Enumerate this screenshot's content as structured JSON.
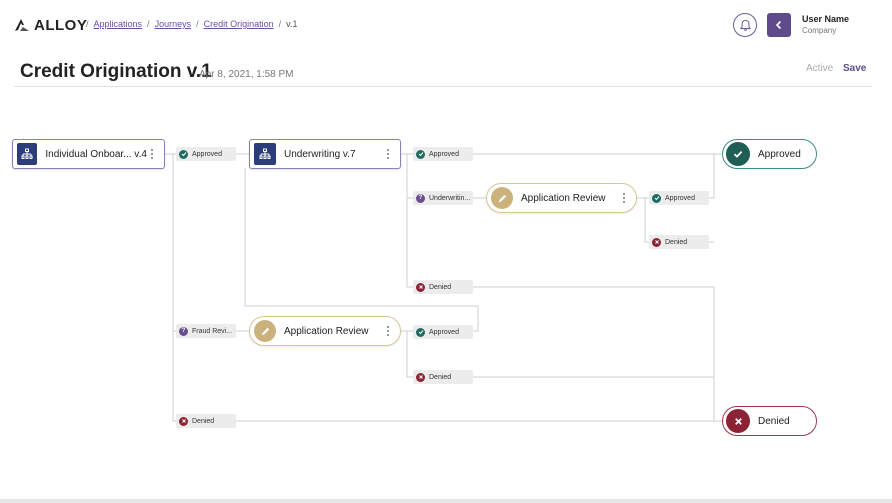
{
  "header": {
    "logo_text": "ALLOY",
    "breadcrumb": [
      {
        "label": "Applications"
      },
      {
        "label": "Journeys"
      },
      {
        "label": "Credit Origination"
      }
    ],
    "breadcrumb_current": "v.1",
    "user_name": "User Name",
    "company": "Company"
  },
  "page": {
    "title": "Credit Origination v.1",
    "timestamp": "Apr 8, 2021, 1:58 PM",
    "status": "Active",
    "save_label": "Save"
  },
  "nodes": {
    "individual_onboarding": "Individual Onboar... v.4",
    "underwriting": "Underwriting v.7",
    "application_review_1": "Application Review",
    "application_review_2": "Application Review",
    "approved_terminal": "Approved",
    "denied_terminal": "Denied"
  },
  "edges": {
    "onboarding_approved": "Approved",
    "onboarding_fraud": "Fraud Revi...",
    "onboarding_denied": "Denied",
    "underwriting_approved": "Approved",
    "underwriting_review": "Underwritin...",
    "underwriting_denied": "Denied",
    "review1_approved": "Approved",
    "review1_denied": "Denied",
    "review2_approved": "Approved",
    "review2_denied": "Denied"
  },
  "colors": {
    "brand_purple": "#5f4b8b",
    "approved_green": "#1e5e54",
    "denied_red": "#8c2335",
    "review_gold": "#cbb27c",
    "journey_blue": "#2c3e7a"
  }
}
